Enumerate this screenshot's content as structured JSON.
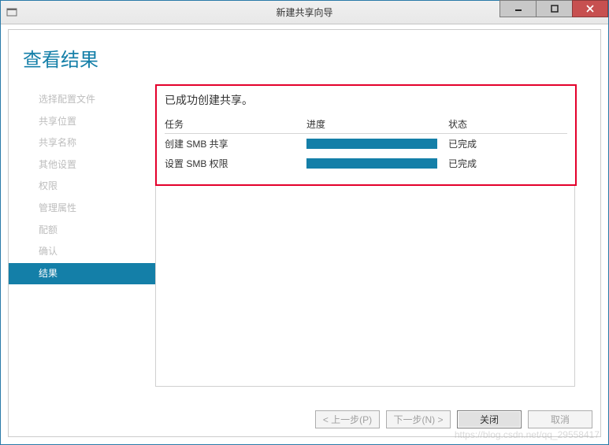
{
  "window": {
    "title": "新建共享向导"
  },
  "page": {
    "heading": "查看结果"
  },
  "sidebar": {
    "items": [
      {
        "label": "选择配置文件"
      },
      {
        "label": "共享位置"
      },
      {
        "label": "共享名称"
      },
      {
        "label": "其他设置"
      },
      {
        "label": "权限"
      },
      {
        "label": "管理属性"
      },
      {
        "label": "配额"
      },
      {
        "label": "确认"
      },
      {
        "label": "结果",
        "selected": true
      }
    ]
  },
  "result": {
    "message": "已成功创建共享。",
    "columns": {
      "task": "任务",
      "progress": "进度",
      "status": "状态"
    },
    "rows": [
      {
        "task": "创建 SMB 共享",
        "status": "已完成"
      },
      {
        "task": "设置 SMB 权限",
        "status": "已完成"
      }
    ]
  },
  "footer": {
    "prev": "< 上一步(P)",
    "next": "下一步(N) >",
    "close": "关闭",
    "cancel": "取消"
  },
  "watermark": "https://blog.csdn.net/qq_29558417"
}
